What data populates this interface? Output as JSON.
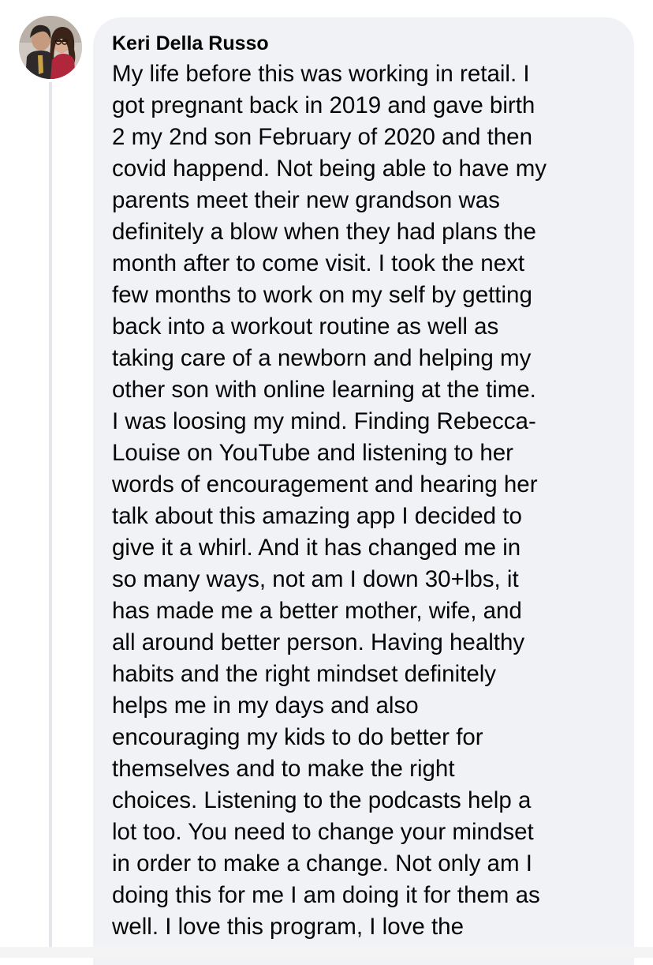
{
  "comment": {
    "author": "Keri Della Russo",
    "avatar_icon": "profile-photo",
    "lines": [
      "My life before this was working in retail. I",
      "got pregnant back in 2019 and gave birth",
      "2 my 2nd son February of 2020 and then",
      "covid happend. Not being able to have my",
      "parents meet their new grandson was",
      "definitely a blow when they had plans the",
      "month after to come visit. I took the next",
      "few months to work on my self by getting",
      "back into a workout routine as well as",
      "taking care of a newborn and helping my",
      "other son with online learning at the time.",
      "I was loosing my mind. Finding Rebecca-",
      "Louise on YouTube and listening to her",
      "words of encouragement and hearing her",
      "talk about this amazing app I decided to",
      "give it a whirl. And it has changed me in",
      "so many ways, not am I down 30+lbs, it",
      "has made me a better mother, wife, and",
      "all around better person. Having healthy",
      "habits and the right mindset definitely",
      "helps me in my days and also",
      "encouraging my kids to do better for",
      "themselves and to make the right",
      "choices. Listening to the podcasts help a",
      "lot too. You need to change your mindset",
      "in order to make a change. Not only am I",
      "doing this for me I am doing it for them as",
      "well. I love this program, I love the"
    ]
  },
  "colors": {
    "bubble_background": "#f0f2f5",
    "text": "#050505",
    "thread_line": "#e4e6eb"
  }
}
